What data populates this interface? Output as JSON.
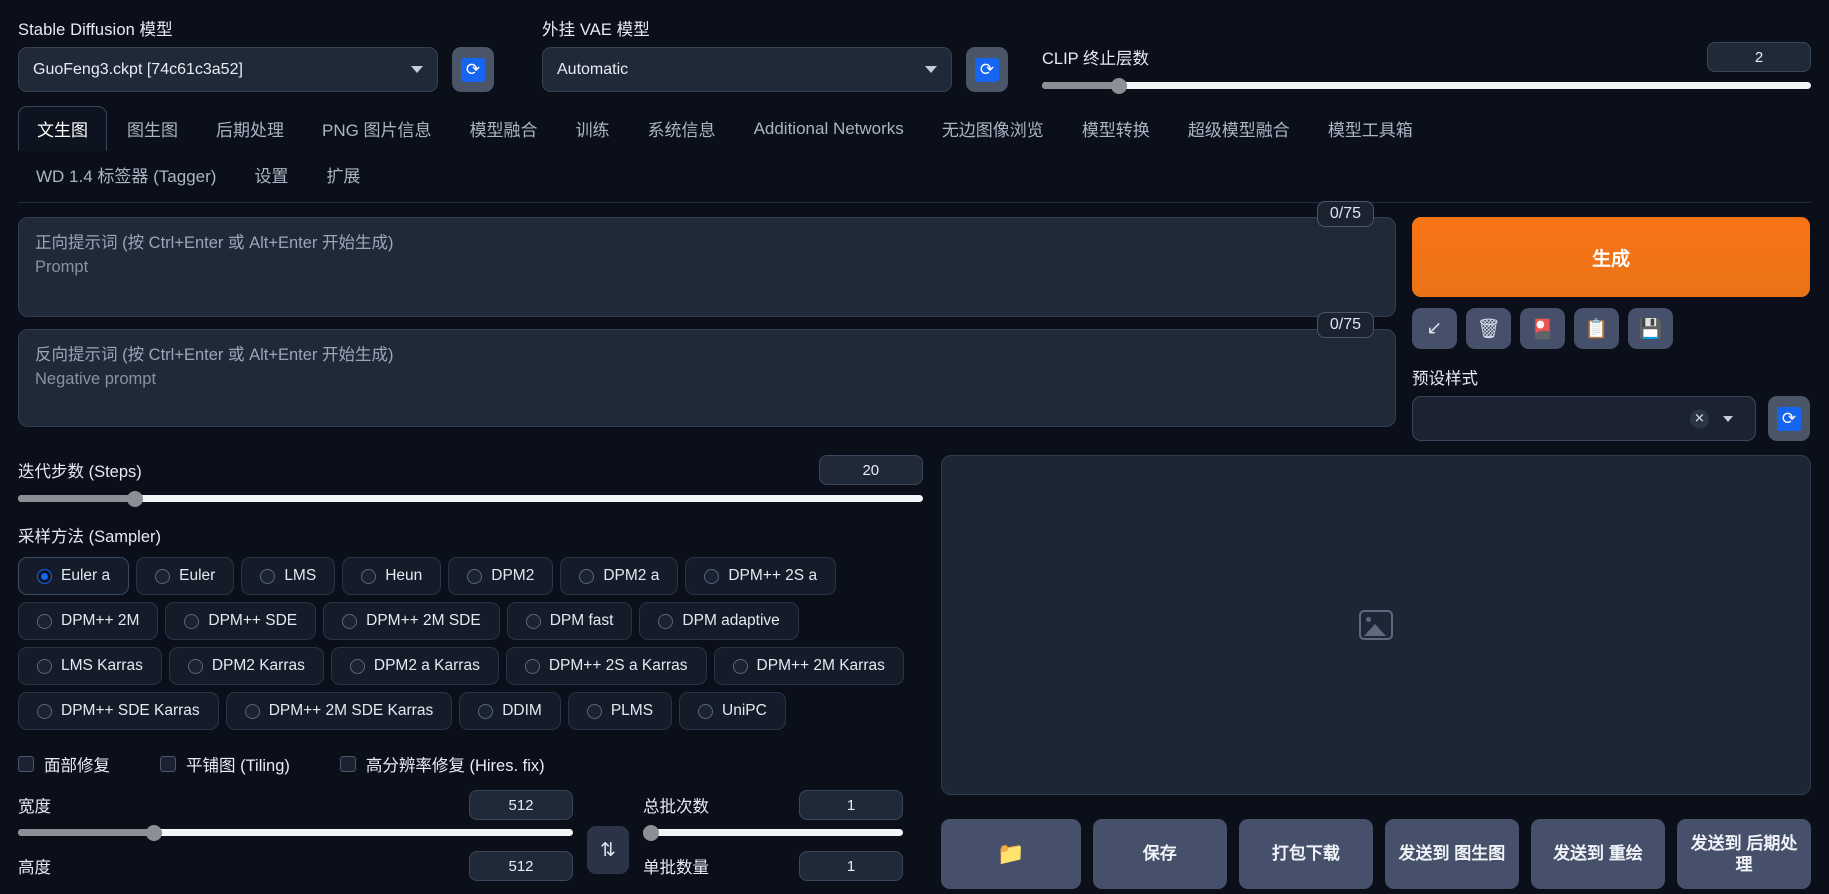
{
  "top": {
    "sd_model_label": "Stable Diffusion 模型",
    "sd_model_value": "GuoFeng3.ckpt [74c61c3a52]",
    "vae_label": "外挂 VAE 模型",
    "vae_value": "Automatic",
    "clip_label": "CLIP 终止层数",
    "clip_value": "2",
    "refresh_icon": "refresh-icon"
  },
  "tabs": {
    "row1": [
      {
        "label": "文生图",
        "active": true
      },
      {
        "label": "图生图",
        "active": false
      },
      {
        "label": "后期处理",
        "active": false
      },
      {
        "label": "PNG 图片信息",
        "active": false
      },
      {
        "label": "模型融合",
        "active": false
      },
      {
        "label": "训练",
        "active": false
      },
      {
        "label": "系统信息",
        "active": false
      },
      {
        "label": "Additional Networks",
        "active": false
      },
      {
        "label": "无边图像浏览",
        "active": false
      },
      {
        "label": "模型转换",
        "active": false
      },
      {
        "label": "超级模型融合",
        "active": false
      },
      {
        "label": "模型工具箱",
        "active": false
      }
    ],
    "row2": [
      {
        "label": "WD 1.4 标签器 (Tagger)",
        "active": false
      },
      {
        "label": "设置",
        "active": false
      },
      {
        "label": "扩展",
        "active": false
      }
    ]
  },
  "prompt": {
    "positive_placeholder": "正向提示词 (按 Ctrl+Enter 或 Alt+Enter 开始生成)",
    "positive_sub": "Prompt",
    "positive_counter": "0/75",
    "negative_placeholder": "反向提示词 (按 Ctrl+Enter 或 Alt+Enter 开始生成)",
    "negative_sub": "Negative prompt",
    "negative_counter": "0/75"
  },
  "actions": {
    "generate_label": "生成",
    "icons": [
      {
        "name": "restore-arrow-icon",
        "glyph": "↙"
      },
      {
        "name": "trash-icon",
        "glyph": "🗑"
      },
      {
        "name": "card-icon",
        "glyph": "🎴"
      },
      {
        "name": "clipboard-icon",
        "glyph": "📋"
      },
      {
        "name": "floppy-save-icon",
        "glyph": "💾"
      }
    ],
    "styles_label": "预设样式",
    "styles_value": "",
    "clear_icon": "✕"
  },
  "params": {
    "steps_label": "迭代步数 (Steps)",
    "steps_value": "20",
    "steps_pct": 13,
    "sampler_label": "采样方法 (Sampler)",
    "samplers": [
      [
        "Euler a",
        "Euler",
        "LMS",
        "Heun",
        "DPM2",
        "DPM2 a",
        "DPM++ 2S a"
      ],
      [
        "DPM++ 2M",
        "DPM++ SDE",
        "DPM++ 2M SDE",
        "DPM fast",
        "DPM adaptive"
      ],
      [
        "LMS Karras",
        "DPM2 Karras",
        "DPM2 a Karras",
        "DPM++ 2S a Karras",
        "DPM++ 2M Karras"
      ],
      [
        "DPM++ SDE Karras",
        "DPM++ 2M SDE Karras",
        "DDIM",
        "PLMS",
        "UniPC"
      ]
    ],
    "selected_sampler": "Euler a",
    "checkboxes": [
      {
        "label": "面部修复",
        "checked": false
      },
      {
        "label": "平铺图 (Tiling)",
        "checked": false
      },
      {
        "label": "高分辨率修复 (Hires. fix)",
        "checked": false
      }
    ],
    "width_label": "宽度",
    "width_value": "512",
    "width_pct": 25,
    "height_label": "高度",
    "height_value": "512",
    "height_pct": 25,
    "batch_count_label": "总批次数",
    "batch_count_value": "1",
    "batch_count_pct": 3,
    "batch_size_label": "单批数量",
    "batch_size_value": "1",
    "swap_icon": "⇅"
  },
  "output": {
    "placeholder_icon": "image-placeholder-icon",
    "buttons": [
      {
        "name": "open-folder-button",
        "label": "📁"
      },
      {
        "name": "save-button",
        "label": "保存"
      },
      {
        "name": "zip-download-button",
        "label": "打包下载"
      },
      {
        "name": "send-to-img2img-button",
        "label": "发送到 图生图"
      },
      {
        "name": "send-to-inpaint-button",
        "label": "发送到 重绘"
      },
      {
        "name": "send-to-extras-button",
        "label": "发送到 后期处理"
      }
    ]
  }
}
